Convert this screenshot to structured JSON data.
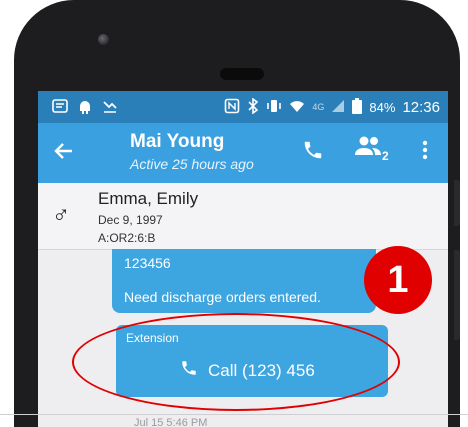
{
  "status_bar": {
    "battery": "84%",
    "time": "12:36",
    "network": "4G"
  },
  "conversation": {
    "title": "Mai Young",
    "subtitle": "Active 25 hours ago",
    "participants_count": "2"
  },
  "patient": {
    "name": "Emma, Emily",
    "dob": "Dec 9, 1997",
    "id": "A:OR2:6:B",
    "gender_symbol": "♂"
  },
  "messages": [
    {
      "line1": "123456",
      "line2": "Need discharge orders entered."
    },
    {
      "label": "Extension",
      "call_label": "Call (123) 456"
    }
  ],
  "timestamp": "Jul 15 5:46 PM",
  "annotation": {
    "number": "1",
    "color": "#e00000"
  },
  "colors": {
    "appbar": "#3aa0e0",
    "statusbar": "#2b7fb8",
    "bubble": "#3da5e0"
  }
}
